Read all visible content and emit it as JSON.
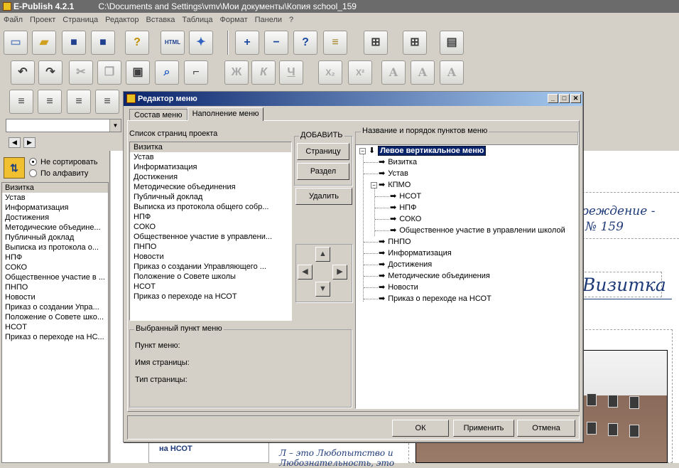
{
  "window": {
    "app": "E-Publish 4.2.1",
    "path": "C:\\Documents and Settings\\vmv\\Мои документы\\Копия school_159"
  },
  "menubar": [
    "Файл",
    "Проект",
    "Страница",
    "Редактор",
    "Вставка",
    "Таблица",
    "Формат",
    "Панели",
    "?"
  ],
  "toolbar1": [
    "new-icon",
    "open-icon",
    "save-icon",
    "save-all-icon",
    "help-icon",
    "html-icon",
    "publish-icon",
    "add-icon",
    "remove-icon",
    "question-icon",
    "list-icon",
    "insert-row-icon",
    "insert-col-icon",
    "table-icon"
  ],
  "toolbar2": {
    "bold": "Ж",
    "italic": "К",
    "underline": "Ч",
    "sub": "X₂",
    "sup": "X²",
    "font": "A"
  },
  "sort": {
    "none": "Не сортировать",
    "alpha": "По алфавиту"
  },
  "left_pages": [
    "Визитка",
    "Устав",
    "Информатизация",
    "Достижения",
    "Методические объедине...",
    "Публичный доклад",
    "Выписка из протокола о...",
    "НПФ",
    "СОКО",
    "Общественное участие в ...",
    "ПНПО",
    "Новости",
    "Приказ о создании Упра...",
    "Положение о Совете шко...",
    "НСОТ",
    "Приказ о переходе на НС..."
  ],
  "doc": {
    "line1": "реждение -",
    "line2": "№ 159",
    "heading": "Визитка",
    "bottom1": "на НСОТ",
    "bottom2": "Л – это Любопытство и",
    "bottom3": "Любознательность, это"
  },
  "dialog": {
    "title": "Редактор меню",
    "tabs": [
      "Состав меню",
      "Наполнение меню"
    ],
    "pages_label": "Список страниц проекта",
    "pages": [
      "Визитка",
      "Устав",
      "Информатизация",
      "Достижения",
      "Методические объединения",
      "Публичный доклад",
      "Выписка из протокола общего собр...",
      "НПФ",
      "СОКО",
      "Общественное участие в управлени...",
      "ПНПО",
      "Новости",
      "Приказ о создании Управляющего ...",
      "Положение о Совете школы",
      "НСОТ",
      "Приказ о переходе на НСОТ"
    ],
    "add_group": "ДОБАВИТЬ",
    "btn_page": "Страницу",
    "btn_section": "Раздел",
    "btn_delete": "Удалить",
    "selected_group": "Выбранный пункт меню",
    "field_item": "Пункт меню:",
    "field_page_name": "Имя страницы:",
    "field_page_type": "Тип страницы:",
    "tree_label": "Название и порядок пунктов меню",
    "tree_root": "Левое вертикальное меню",
    "tree_items_l1a": [
      "Визитка",
      "Устав",
      "КПМО"
    ],
    "tree_items_l2": [
      "НСОТ",
      "НПФ",
      "СОКО",
      "Общественное участие в управлении школой"
    ],
    "tree_items_l1b": [
      "ПНПО",
      "Информатизация",
      "Достижения",
      "Методические объединения",
      "Новости",
      "Приказ о переходе на НСОТ"
    ],
    "ok": "ОК",
    "apply": "Применить",
    "cancel": "Отмена"
  }
}
